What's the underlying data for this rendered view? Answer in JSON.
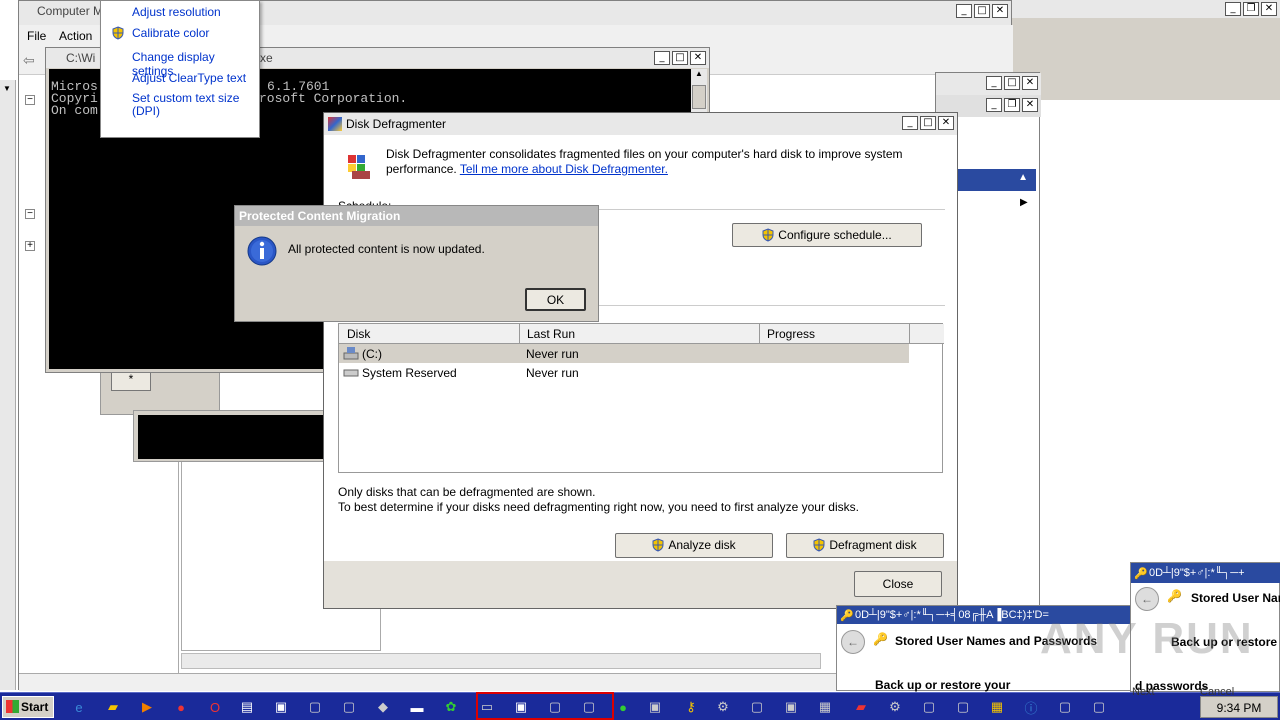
{
  "computer_mgmt": {
    "title": "Computer M",
    "menu": [
      "File",
      "Action"
    ]
  },
  "context_menu": {
    "items": [
      "Adjust resolution",
      "Calibrate color",
      "Change display settings",
      "Adjust ClearType text",
      "Set custom text size (DPI)"
    ]
  },
  "cmd": {
    "title": "C:\\Wi",
    "title_tail": "xe",
    "lines": [
      "Micros",
      "Copyri",
      "On com"
    ],
    "lines_tail": [
      "6.1.7601",
      "rosoft Corporation.",
      ""
    ]
  },
  "defrag": {
    "title": "Disk Defragmenter",
    "description": "Disk Defragmenter consolidates fragmented files on your computer's hard disk to improve system performance.",
    "link": "Tell me more about Disk Defragmenter.",
    "schedule_label": "Schedule:",
    "configure_button": "Configure schedule...",
    "columns": [
      "Disk",
      "Last Run",
      "Progress"
    ],
    "disks": [
      {
        "name": "(C:)",
        "last_run": "Never run",
        "progress": ""
      },
      {
        "name": "System Reserved",
        "last_run": "Never run",
        "progress": ""
      }
    ],
    "note1": "Only disks that can be defragmented are shown.",
    "note2": "To best determine if your disks need defragmenting right now, you need to first analyze your disks.",
    "analyze_button": "Analyze disk",
    "defrag_button": "Defragment disk",
    "close_button": "Close"
  },
  "dialog": {
    "title": "Protected Content Migration",
    "message": "All protected content is now updated.",
    "ok": "OK"
  },
  "credman": {
    "title_garbled": "0D┴|9\"$+♂|:*╙┐─+╡08╔╫A▐BC‡)‡'D=",
    "title_garbled_short": "0D┴|9\"$+♂|:*╙┐─+",
    "stored": "Stored User Names and Passwords",
    "stored_short": "Stored User Nar",
    "backup": "Back up or restore y",
    "backup_full": "Back up or restore your",
    "passwords": "d passwords",
    "next": "Next",
    "cancel": "Cancel"
  },
  "taskbar": {
    "start": "Start",
    "clock": "9:34 PM"
  },
  "watermark": "ANY RUN",
  "colors": {
    "taskbar": "#1a2a9a",
    "titlebar_blue": "#2a4aa0",
    "link": "#0033cc",
    "dialog_title": "#b8b8b8"
  }
}
